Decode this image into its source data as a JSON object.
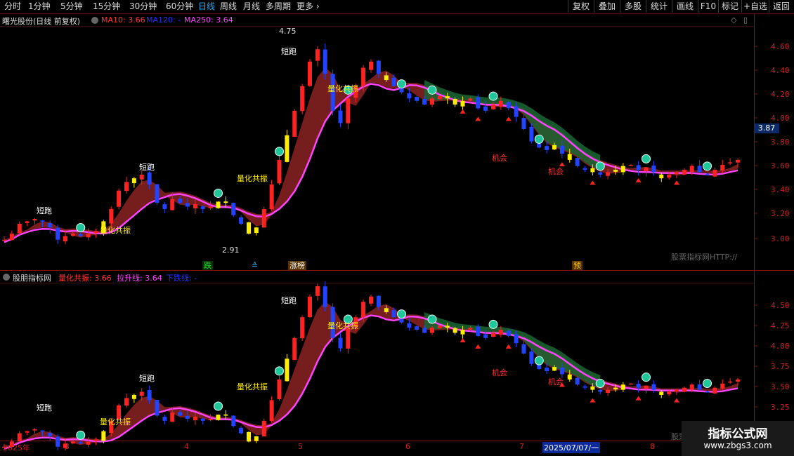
{
  "toolbar": {
    "left_items": [
      "分时",
      "1分钟",
      "5分钟",
      "15分钟",
      "30分钟",
      "60分钟",
      "日线",
      "周线",
      "月线",
      "多周期",
      "更多"
    ],
    "active": "日线",
    "right_items": [
      "复权",
      "叠加",
      "多股",
      "统计",
      "画线",
      "F10",
      "+自选",
      "返回"
    ]
  },
  "main_panel": {
    "stock_title": "曙光股份(日线 前复权)",
    "ma_legends": [
      {
        "label": "MA10: 3.66",
        "color": "#ff3333"
      },
      {
        "label": "MA120: -",
        "color": "#2233ff"
      },
      {
        "label": "MA250: 3.64",
        "color": "#ff44ff"
      }
    ],
    "y_ticks": [
      "4.60",
      "4.40",
      "4.20",
      "4.00",
      "3.80",
      "3.60",
      "3.40",
      "3.20",
      "3.00"
    ],
    "current_price": "3.87",
    "high_label": "4.75",
    "low_label": "2.91",
    "watermark": "股票指标网HTTP://",
    "bottom_markers": [
      {
        "text": "跌",
        "color": "#22dd22",
        "bg": "#003300"
      },
      {
        "text": "涨榜",
        "color": "#ffffff",
        "bg": "#553300"
      },
      {
        "text": "预",
        "color": "#ffcc00",
        "bg": "#553300"
      }
    ]
  },
  "lower_panel": {
    "indicator_title": "股朋指标网",
    "legends": [
      {
        "label": "量化共振: 3.66",
        "color": "#ff3333"
      },
      {
        "label": "拉升线: 3.64",
        "color": "#ff44ff"
      },
      {
        "label": "下跌线: -",
        "color": "#2233ff"
      }
    ],
    "y_ticks": [
      "4.50",
      "4.25",
      "4.00",
      "3.75",
      "3.50",
      "3.25"
    ],
    "watermark": "股票"
  },
  "annotations": {
    "short_run": "短跑",
    "resonance": "量化共振",
    "opportunity": "机会"
  },
  "x_axis": {
    "labels": [
      "2025年",
      "3",
      "4",
      "5",
      "6",
      "7",
      "8"
    ],
    "cursor_date": "2025/07/07/一"
  },
  "brand": {
    "name": "指标公式网",
    "url": "www.zbgs3.com"
  },
  "colors": {
    "up": "#ff2222",
    "down": "#2244ff",
    "yellow": "#ffee00",
    "ma_pink": "#ff44ff",
    "ribbon_red": "#8b2222",
    "ribbon_green": "#1a6633"
  },
  "chart_data": {
    "type": "candlestick",
    "x_range": [
      "2025-02",
      "2025-08"
    ],
    "ylim_main": [
      2.9,
      4.75
    ],
    "ylim_lower": [
      3.15,
      4.6
    ],
    "price_path": [
      3.05,
      3.1,
      3.18,
      3.2,
      3.22,
      3.2,
      3.15,
      3.05,
      3.08,
      3.1,
      3.08,
      3.1,
      3.12,
      3.2,
      3.3,
      3.45,
      3.52,
      3.55,
      3.58,
      3.5,
      3.35,
      3.3,
      3.38,
      3.35,
      3.32,
      3.34,
      3.3,
      3.32,
      3.36,
      3.35,
      3.25,
      3.18,
      3.1,
      3.15,
      3.3,
      3.5,
      3.7,
      3.9,
      4.1,
      4.3,
      4.5,
      4.6,
      4.4,
      4.1,
      4.0,
      4.2,
      4.3,
      4.45,
      4.5,
      4.4,
      4.35,
      4.3,
      4.25,
      4.2,
      4.18,
      4.15,
      4.2,
      4.22,
      4.2,
      4.15,
      4.18,
      4.2,
      4.12,
      4.1,
      4.15,
      4.18,
      4.12,
      4.05,
      3.95,
      3.85,
      3.8,
      3.78,
      3.82,
      3.75,
      3.7,
      3.65,
      3.62,
      3.6,
      3.58,
      3.6,
      3.62,
      3.65,
      3.66,
      3.62,
      3.64,
      3.6,
      3.55,
      3.58,
      3.6,
      3.62,
      3.65,
      3.6,
      3.58,
      3.62,
      3.66,
      3.68,
      3.7
    ]
  }
}
